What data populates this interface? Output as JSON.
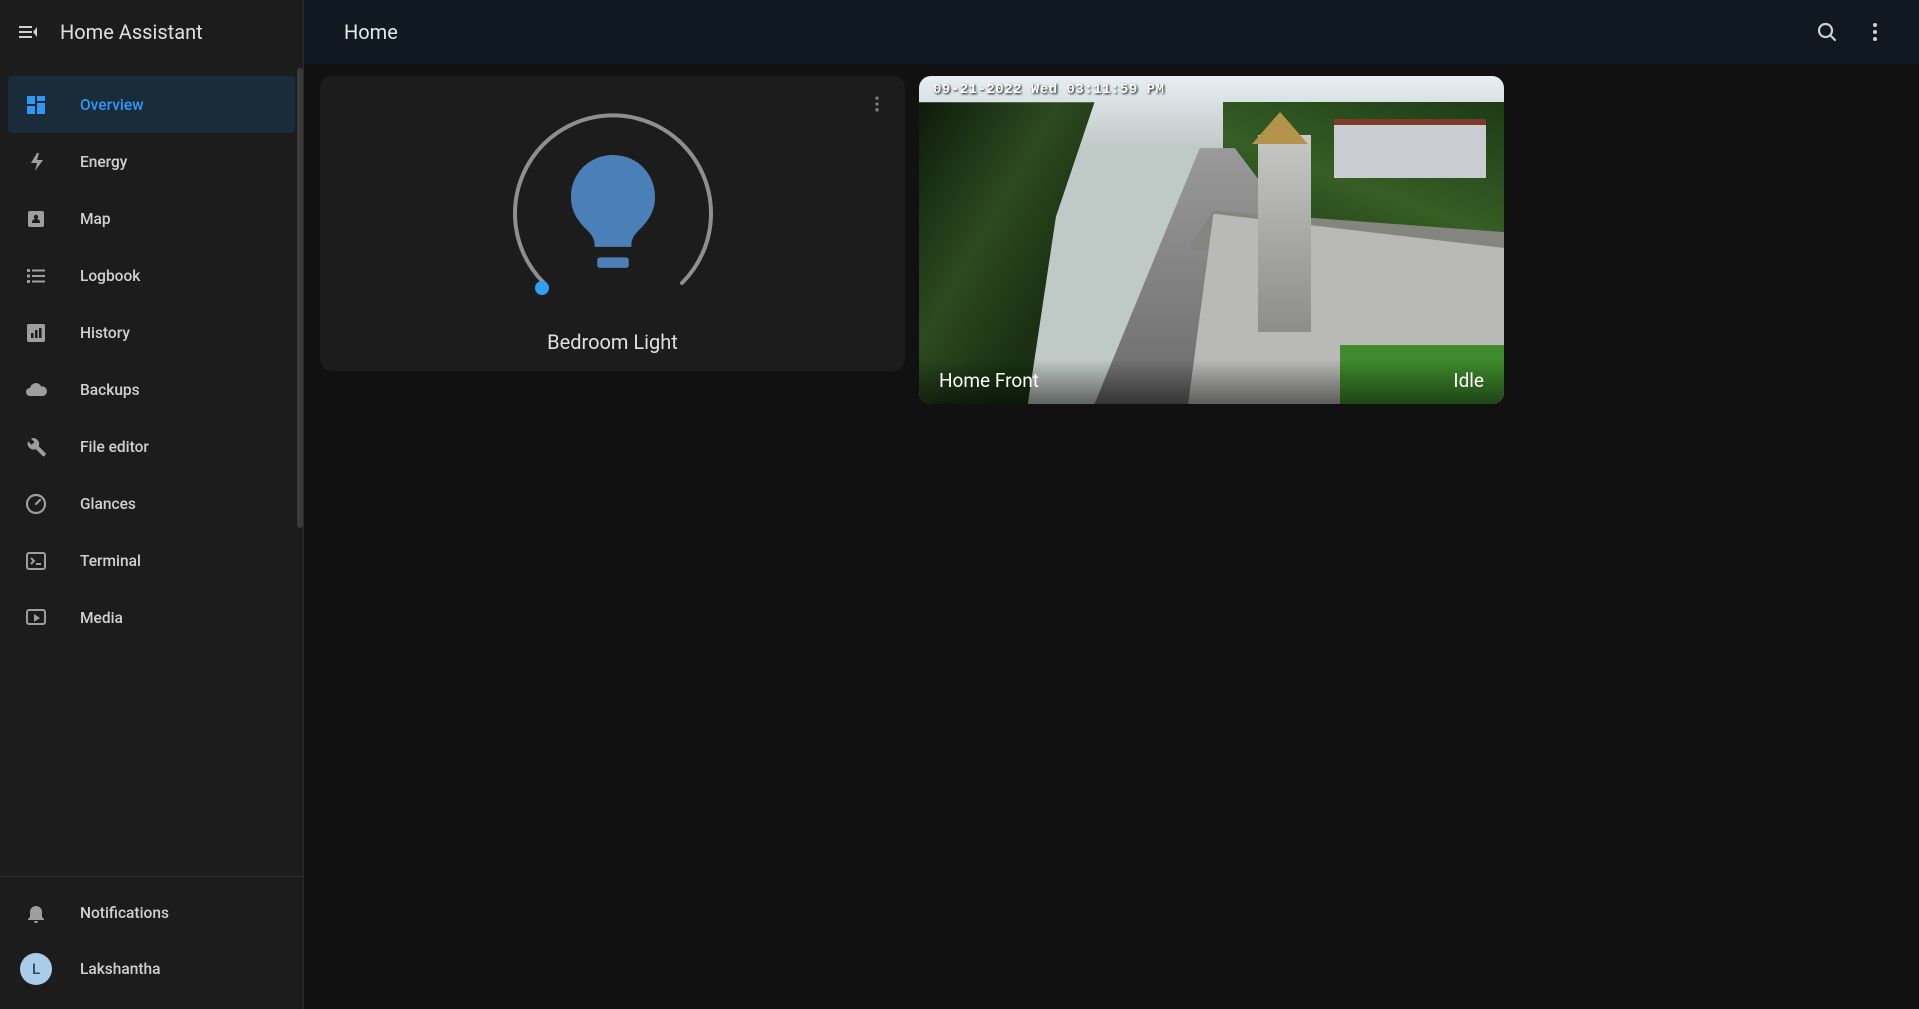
{
  "app": {
    "title": "Home Assistant"
  },
  "sidebar": {
    "items": [
      {
        "id": "overview",
        "label": "Overview",
        "icon": "dashboard-icon",
        "active": true
      },
      {
        "id": "energy",
        "label": "Energy",
        "icon": "bolt-icon"
      },
      {
        "id": "map",
        "label": "Map",
        "icon": "map-pin-icon"
      },
      {
        "id": "logbook",
        "label": "Logbook",
        "icon": "list-icon"
      },
      {
        "id": "history",
        "label": "History",
        "icon": "chart-icon"
      },
      {
        "id": "backups",
        "label": "Backups",
        "icon": "cloud-icon"
      },
      {
        "id": "fileeditor",
        "label": "File editor",
        "icon": "wrench-icon"
      },
      {
        "id": "glances",
        "label": "Glances",
        "icon": "gauge-icon"
      },
      {
        "id": "terminal",
        "label": "Terminal",
        "icon": "terminal-icon"
      },
      {
        "id": "media",
        "label": "Media",
        "icon": "play-icon"
      }
    ],
    "footer": {
      "notifications_label": "Notifications",
      "user_name": "Lakshantha",
      "user_initial": "L"
    }
  },
  "topbar": {
    "view_title": "Home"
  },
  "cards": {
    "light": {
      "name": "Bedroom Light",
      "brightness_pct": 0,
      "on": false,
      "bulb_color": "#4a7fb8"
    },
    "camera": {
      "name": "Home Front",
      "status": "Idle",
      "timestamp_overlay": "09-21-2022 Wed 03:11:59 PM"
    }
  }
}
